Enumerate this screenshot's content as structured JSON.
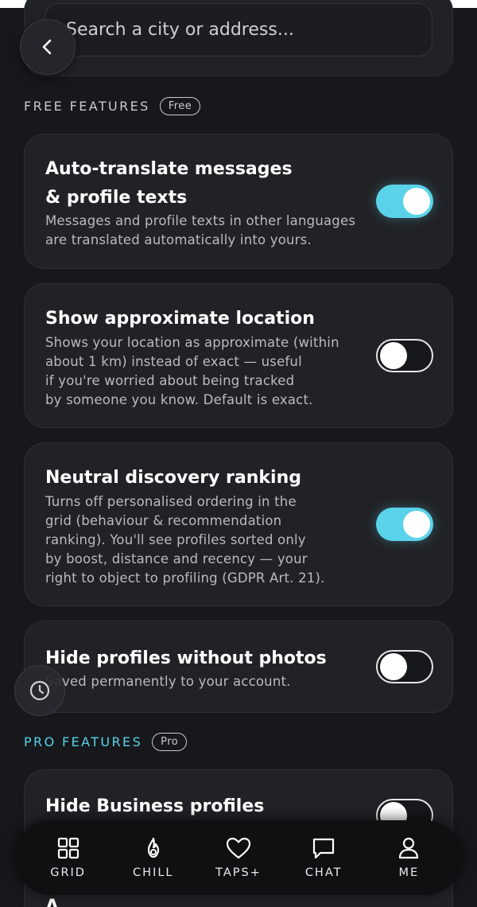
{
  "search": {
    "placeholder": "Search a city or address..."
  },
  "sections": {
    "free": {
      "label": "FREE FEATURES",
      "badge": "Free"
    },
    "pro": {
      "label": "PRO FEATURES",
      "badge": "Pro"
    }
  },
  "settings": [
    {
      "title_line1": "Auto-translate messages",
      "title_line2": "& profile texts",
      "desc": [
        "Messages and profile texts in other languages",
        "are translated automatically into yours."
      ],
      "enabled": true
    },
    {
      "title": "Show approximate location",
      "desc": [
        "Shows your location as approximate (within",
        "about 1 km) instead of exact — useful",
        "if you're worried about being tracked",
        "by someone you know. Default is exact."
      ],
      "enabled": false
    },
    {
      "title": "Neutral discovery ranking",
      "desc": [
        "Turns off personalised ordering in the",
        "grid (behaviour & recommendation",
        "ranking). You'll see profiles sorted only",
        "by boost, distance and recency — your",
        "right to object to profiling (GDPR Art. 21)."
      ],
      "enabled": true
    },
    {
      "title": "Hide profiles without photos",
      "desc": [
        "Saved permanently to your account."
      ],
      "enabled": false
    },
    {
      "title": "Hide Business profiles",
      "enabled": false
    }
  ],
  "partial_next": "A",
  "tabbar": [
    {
      "label": "GRID",
      "icon": "grid-icon"
    },
    {
      "label": "CHILL",
      "icon": "flame-icon"
    },
    {
      "label": "TAPS+",
      "icon": "heart-icon"
    },
    {
      "label": "CHAT",
      "icon": "chat-bubble-icon"
    },
    {
      "label": "ME",
      "icon": "person-icon"
    }
  ],
  "colors": {
    "accent": "#5ad3ea",
    "background": "#17181b",
    "card": "#212226"
  }
}
